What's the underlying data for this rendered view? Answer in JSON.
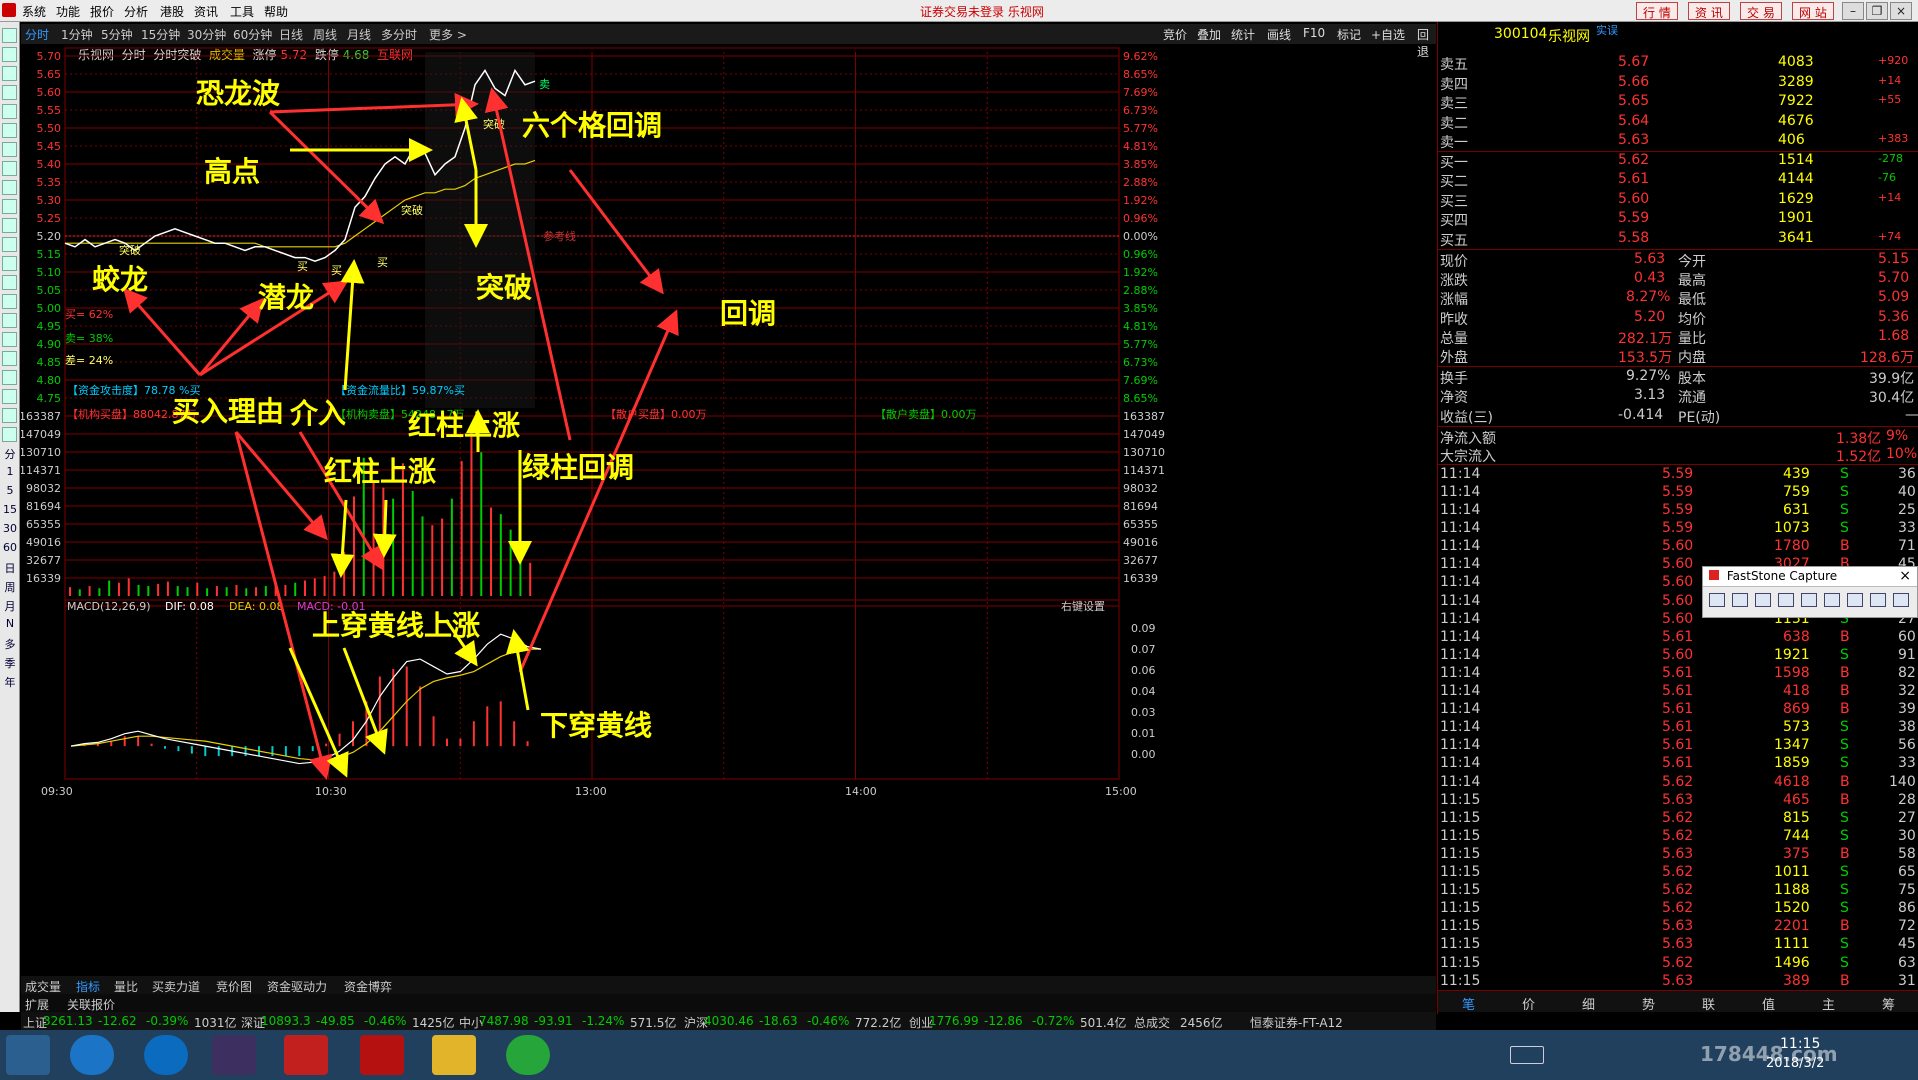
{
  "menu": {
    "items": [
      "系统",
      "功能",
      "报价",
      "分析",
      "港股",
      "资讯",
      "工具",
      "帮助"
    ],
    "center_text": "证券交易未登录  乐视网",
    "right_buttons": [
      "行 情",
      "资 讯",
      "交 易",
      "网 站"
    ]
  },
  "tabs": {
    "items": [
      "分时",
      "1分钟",
      "5分钟",
      "15分钟",
      "30分钟",
      "60分钟",
      "日线",
      "周线",
      "月线",
      "多分时",
      "更多 >"
    ],
    "active": "分时",
    "right_tools": [
      "竞价",
      "叠加",
      "统计",
      "画线",
      "F10",
      "标记",
      "+自选",
      "回退"
    ]
  },
  "info": {
    "stock_name": "乐视网",
    "tab1": "分时",
    "tab2": "分时突破",
    "label_vol": "成交量",
    "zt_label": "涨停",
    "zt_val": "5.72",
    "dt_label": "跌停",
    "dt_val": "4.68",
    "hulian": "互联网"
  },
  "chart_data": [
    {
      "type": "line",
      "name": "price",
      "series": [
        {
          "name": "price",
          "values": [
            5.18,
            5.17,
            5.19,
            5.17,
            5.18,
            5.19,
            5.18,
            5.16,
            5.18,
            5.2,
            5.21,
            5.22,
            5.21,
            5.2,
            5.19,
            5.18,
            5.18,
            5.17,
            5.16,
            5.17,
            5.17,
            5.16,
            5.15,
            5.14,
            5.14,
            5.13,
            5.14,
            5.16,
            5.19,
            5.28,
            5.31,
            5.36,
            5.4,
            5.42,
            5.4,
            5.45,
            5.43,
            5.37,
            5.4,
            5.42,
            5.5,
            5.62,
            5.66,
            5.61,
            5.59,
            5.66,
            5.62,
            5.63
          ]
        },
        {
          "name": "avg",
          "values": [
            5.18,
            5.18,
            5.18,
            5.18,
            5.18,
            5.18,
            5.18,
            5.18,
            5.18,
            5.18,
            5.18,
            5.18,
            5.18,
            5.18,
            5.18,
            5.18,
            5.18,
            5.18,
            5.18,
            5.18,
            5.17,
            5.17,
            5.17,
            5.17,
            5.17,
            5.17,
            5.17,
            5.17,
            5.18,
            5.2,
            5.22,
            5.24,
            5.26,
            5.28,
            5.3,
            5.31,
            5.32,
            5.32,
            5.33,
            5.33,
            5.34,
            5.36,
            5.37,
            5.38,
            5.39,
            5.4,
            5.4,
            5.41
          ]
        }
      ],
      "y_ticks": [
        "5.70",
        "5.65",
        "5.60",
        "5.55",
        "5.50",
        "5.45",
        "5.40",
        "5.35",
        "5.30",
        "5.25",
        "5.20",
        "5.15",
        "5.10",
        "5.05",
        "5.00",
        "4.95",
        "4.90",
        "4.85",
        "4.80",
        "4.75"
      ],
      "pct_ticks": [
        "9.62%",
        "8.65%",
        "7.69%",
        "6.73%",
        "5.77%",
        "4.81%",
        "3.85%",
        "2.88%",
        "1.92%",
        "0.96%",
        "0.00%",
        "0.96%",
        "1.92%",
        "2.88%",
        "3.85%",
        "4.81%",
        "5.77%",
        "6.73%",
        "7.69%",
        "8.65%"
      ],
      "ylim": [
        4.75,
        5.7
      ],
      "ref_label": "参考线",
      "inline_labels": [
        "突破",
        "买",
        "买",
        "买",
        "突破",
        "突破",
        "卖"
      ]
    },
    {
      "type": "bar",
      "name": "volume",
      "y_ticks": [
        "163387",
        "147049",
        "130710",
        "114371",
        "98032",
        "81694",
        "65355",
        "49016",
        "32677",
        "16339"
      ],
      "values": [
        8000,
        6000,
        9000,
        7000,
        14000,
        12000,
        16000,
        10000,
        9000,
        11000,
        13000,
        9000,
        8000,
        12000,
        7000,
        9000,
        8000,
        10000,
        7000,
        8000,
        9000,
        11000,
        10000,
        12000,
        14000,
        16000,
        18000,
        22000,
        40000,
        90000,
        125000,
        104000,
        98000,
        88000,
        120000,
        95000,
        72000,
        64000,
        70000,
        88000,
        122000,
        150000,
        130000,
        80000,
        74000,
        60000,
        48000,
        30000
      ],
      "colors": [
        "r",
        "g",
        "r",
        "g",
        "g",
        "r",
        "r",
        "g",
        "g",
        "r",
        "r",
        "g",
        "g",
        "r",
        "g",
        "r",
        "g",
        "r",
        "g",
        "r",
        "g",
        "r",
        "r",
        "g",
        "r",
        "r",
        "r",
        "r",
        "r",
        "r",
        "g",
        "r",
        "r",
        "g",
        "r",
        "g",
        "g",
        "r",
        "r",
        "g",
        "r",
        "r",
        "g",
        "r",
        "g",
        "g",
        "g",
        "r"
      ],
      "ylim": [
        0,
        170000
      ]
    },
    {
      "type": "bar",
      "name": "macd",
      "title": "MACD(12,26,9)",
      "dif_label": "DIF: 0.08",
      "dea_label": "DEA: 0.08",
      "macd_label": "MACD: -0.01",
      "y_ticks": [
        "0.09",
        "0.07",
        "0.06",
        "0.04",
        "0.03",
        "0.01",
        "0.00"
      ],
      "dif": [
        0.0,
        0.002,
        0.003,
        0.006,
        0.01,
        0.012,
        0.009,
        0.006,
        0.004,
        0.002,
        0.0,
        -0.002,
        -0.004,
        -0.006,
        -0.008,
        -0.01,
        -0.012,
        -0.014,
        -0.013,
        -0.01,
        -0.004,
        0.005,
        0.02,
        0.04,
        0.055,
        0.068,
        0.07,
        0.064,
        0.058,
        0.06,
        0.07,
        0.082,
        0.09,
        0.086,
        0.08,
        0.078
      ],
      "dea": [
        0.0,
        0.001,
        0.002,
        0.004,
        0.006,
        0.008,
        0.008,
        0.007,
        0.006,
        0.005,
        0.004,
        0.002,
        0.0,
        -0.002,
        -0.004,
        -0.006,
        -0.008,
        -0.01,
        -0.011,
        -0.011,
        -0.009,
        -0.005,
        0.002,
        0.012,
        0.024,
        0.036,
        0.046,
        0.052,
        0.055,
        0.057,
        0.06,
        0.066,
        0.072,
        0.076,
        0.078,
        0.078
      ],
      "hist": [
        0.0,
        0.002,
        0.002,
        0.004,
        0.008,
        0.008,
        0.002,
        -0.002,
        -0.004,
        -0.006,
        -0.008,
        -0.008,
        -0.008,
        -0.008,
        -0.008,
        -0.008,
        -0.008,
        -0.008,
        -0.004,
        0.002,
        0.01,
        0.02,
        0.036,
        0.056,
        0.062,
        0.064,
        0.048,
        0.024,
        0.006,
        0.006,
        0.02,
        0.032,
        0.036,
        0.02,
        0.004,
        0.0
      ],
      "ylim": [
        -0.02,
        0.095
      ],
      "x_ticks": [
        "09:30",
        "10:30",
        "13:00",
        "14:00",
        "15:00"
      ],
      "right_setting": "右键设置"
    }
  ],
  "panel_labels": {
    "buy_pct": "买= 62%",
    "sell_pct": "卖= 38%",
    "diff_pct": "差= 24%",
    "fund_attack": "【资金攻击度】78.78 %买",
    "fund_flow": "【资金流量比】59.87%买",
    "inst_buy": "【机构买盘】88042.87万",
    "inst_sell": "【机构卖盘】54248.17万",
    "retail_buy": "【散户买盘】0.00万",
    "retail_sell": "【散户卖盘】0.00万"
  },
  "annotations": [
    "恐龙波",
    "高点",
    "六个格回调",
    "蛟龙",
    "潜龙",
    "突破",
    "回调",
    "买入理由",
    "介入",
    "红柱上涨",
    "红柱上涨",
    "绿柱回调",
    "上穿黄线上涨",
    "下穿黄线"
  ],
  "quote": {
    "code": "300104",
    "name": "乐视网",
    "tag": "实误",
    "sell": [
      [
        "卖五",
        "5.67",
        "4083",
        "+920"
      ],
      [
        "卖四",
        "5.66",
        "3289",
        "+14"
      ],
      [
        "卖三",
        "5.65",
        "7922",
        "+55"
      ],
      [
        "卖二",
        "5.64",
        "4676",
        ""
      ],
      [
        "卖一",
        "5.63",
        "406",
        "+383"
      ]
    ],
    "buy": [
      [
        "买一",
        "5.62",
        "1514",
        "-278"
      ],
      [
        "买二",
        "5.61",
        "4144",
        "-76"
      ],
      [
        "买三",
        "5.60",
        "1629",
        "+14"
      ],
      [
        "买四",
        "5.59",
        "1901",
        ""
      ],
      [
        "买五",
        "5.58",
        "3641",
        "+74"
      ]
    ],
    "stats": [
      [
        "现价",
        "5.63",
        "今开",
        "5.15"
      ],
      [
        "涨跌",
        "0.43",
        "最高",
        "5.70"
      ],
      [
        "涨幅",
        "8.27%",
        "最低",
        "5.09"
      ],
      [
        "昨收",
        "5.20",
        "均价",
        "5.36"
      ],
      [
        "总量",
        "282.1万",
        "量比",
        "1.68"
      ],
      [
        "外盘",
        "153.5万",
        "内盘",
        "128.6万"
      ],
      [
        "换手",
        "9.27%",
        "股本",
        "39.9亿"
      ],
      [
        "净资",
        "3.13",
        "流通",
        "30.4亿"
      ],
      [
        "收益(三)",
        "-0.414",
        "PE(动)",
        "—"
      ]
    ],
    "flows": [
      [
        "净流入额",
        "1.38亿",
        "9%"
      ],
      [
        "大宗流入",
        "1.52亿",
        "10%"
      ]
    ],
    "ticks": [
      [
        "11:14",
        "5.59",
        "439",
        "S",
        "36"
      ],
      [
        "11:14",
        "5.59",
        "759",
        "S",
        "40"
      ],
      [
        "11:14",
        "5.59",
        "631",
        "S",
        "25"
      ],
      [
        "11:14",
        "5.59",
        "1073",
        "S",
        "33"
      ],
      [
        "11:14",
        "5.60",
        "1780",
        "B",
        "71"
      ],
      [
        "11:14",
        "5.60",
        "3027",
        "B",
        "45"
      ],
      [
        "11:14",
        "5.60",
        "1285",
        "B",
        "34"
      ],
      [
        "11:14",
        "5.60",
        "2167",
        "B",
        "67"
      ],
      [
        "11:14",
        "5.60",
        "1131",
        "S",
        "27"
      ],
      [
        "11:14",
        "5.61",
        "638",
        "B",
        "60"
      ],
      [
        "11:14",
        "5.60",
        "1921",
        "S",
        "91"
      ],
      [
        "11:14",
        "5.61",
        "1598",
        "B",
        "82"
      ],
      [
        "11:14",
        "5.61",
        "418",
        "B",
        "32"
      ],
      [
        "11:14",
        "5.61",
        "869",
        "B",
        "39"
      ],
      [
        "11:14",
        "5.61",
        "573",
        "S",
        "38"
      ],
      [
        "11:14",
        "5.61",
        "1347",
        "S",
        "56"
      ],
      [
        "11:14",
        "5.61",
        "1859",
        "S",
        "33"
      ],
      [
        "11:14",
        "5.62",
        "4618",
        "B",
        "140"
      ],
      [
        "11:15",
        "5.63",
        "465",
        "B",
        "28"
      ],
      [
        "11:15",
        "5.62",
        "815",
        "S",
        "27"
      ],
      [
        "11:15",
        "5.62",
        "744",
        "S",
        "30"
      ],
      [
        "11:15",
        "5.63",
        "375",
        "B",
        "58"
      ],
      [
        "11:15",
        "5.62",
        "1011",
        "S",
        "65"
      ],
      [
        "11:15",
        "5.62",
        "1188",
        "S",
        "75"
      ],
      [
        "11:15",
        "5.62",
        "1520",
        "S",
        "86"
      ],
      [
        "11:15",
        "5.63",
        "2201",
        "B",
        "72"
      ],
      [
        "11:15",
        "5.63",
        "1111",
        "S",
        "45"
      ],
      [
        "11:15",
        "5.62",
        "1496",
        "S",
        "63"
      ],
      [
        "11:15",
        "5.63",
        "389",
        "B",
        "31"
      ]
    ],
    "bottom_tabs": [
      "笔",
      "价",
      "细",
      "势",
      "联",
      "值",
      "主",
      "筹"
    ]
  },
  "bottom_tabs": [
    "成交量",
    "指标",
    "量比",
    "买卖力道",
    "竞价图",
    "资金驱动力",
    "资金博弈"
  ],
  "sidebar_extra": [
    "扩展",
    "关联报价"
  ],
  "status": [
    [
      "上证",
      "3261.13",
      "-12.62",
      "-0.39%",
      "1031亿"
    ],
    [
      "深证",
      "10893.3",
      "-49.85",
      "-0.46%",
      "1425亿"
    ],
    [
      "中小",
      "7487.98",
      "-93.91",
      "-1.24%",
      "571.5亿"
    ],
    [
      "沪深",
      "4030.46",
      "-18.63",
      "-0.46%",
      "772.2亿"
    ],
    [
      "创业",
      "1776.99",
      "-12.86",
      "-0.72%",
      "501.4亿"
    ]
  ],
  "status_extra": {
    "label": "总成交",
    "value": "2456亿",
    "broker": "恒泰证券-FT-A12"
  },
  "popup": {
    "title": "FastStone Capture"
  },
  "clock": {
    "time": "11:15",
    "date": "2018/3/2"
  },
  "watermark": "178448.com",
  "leftbar_labels": [
    "分",
    "1",
    "5",
    "15",
    "30",
    "60",
    "日",
    "周",
    "月",
    "N",
    "多",
    "季",
    "年"
  ],
  "colors": {
    "up": "#ff3232",
    "down": "#00cc00",
    "grid": "#800000",
    "annotation": "#ffff00"
  }
}
